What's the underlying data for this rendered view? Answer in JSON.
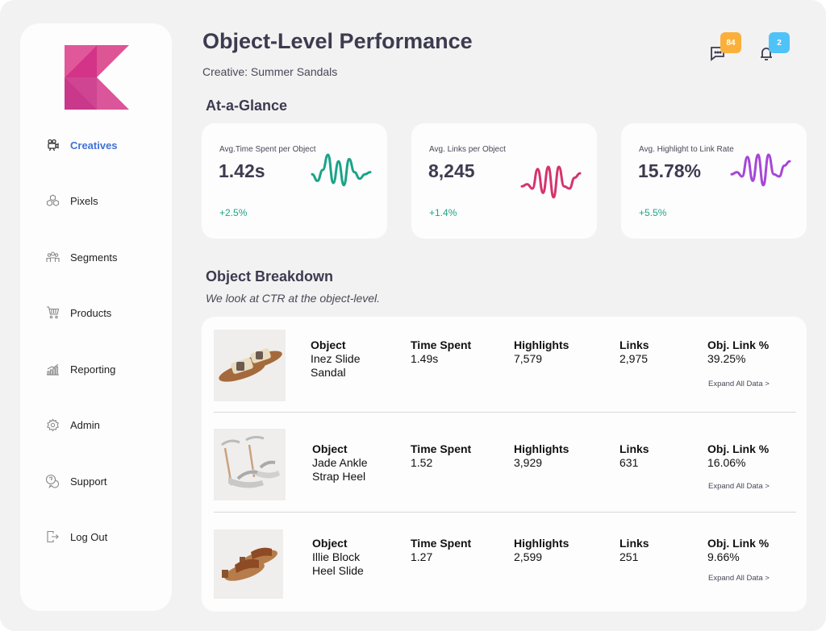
{
  "header": {
    "title": "Object-Level Performance",
    "subtitle": "Creative: Summer Sandals",
    "messages_count": "84",
    "notifications_count": "2",
    "messages_badge_color": "#fbb03b",
    "notifications_badge_color": "#4fc3f7"
  },
  "sidebar": {
    "items": [
      {
        "label": "Creatives",
        "icon": "camera-icon",
        "active": true
      },
      {
        "label": "Pixels",
        "icon": "cubes-icon"
      },
      {
        "label": "Segments",
        "icon": "people-icon"
      },
      {
        "label": "Products",
        "icon": "cart-icon"
      },
      {
        "label": "Reporting",
        "icon": "bar-chart-icon"
      },
      {
        "label": "Admin",
        "icon": "gear-icon"
      },
      {
        "label": "Support",
        "icon": "help-chat-icon"
      },
      {
        "label": "Log Out",
        "icon": "logout-icon"
      }
    ],
    "active_color": "#3f72d8"
  },
  "glance": {
    "title": "At-a-Glance",
    "cards": [
      {
        "label": "Avg.Time Spent per Object",
        "value": "1.42s",
        "delta": "+2.5%",
        "color": "#1aa388",
        "trend": [
          0.55,
          0.4,
          0.65,
          1.0,
          0.35,
          0.85,
          0.3,
          0.9,
          0.6,
          0.45,
          0.55,
          0.6
        ]
      },
      {
        "label": "Avg. Links per Object",
        "value": "8,245",
        "delta": "+1.4%",
        "color": "#d6336c",
        "trend": [
          0.55,
          0.6,
          0.5,
          0.95,
          0.4,
          1.0,
          0.3,
          1.0,
          0.55,
          0.5,
          0.75,
          0.85
        ]
      },
      {
        "label": "Avg. Highlight to Link Rate",
        "value": "15.78%",
        "delta": "+5.5%",
        "color": "#a646d8",
        "trend": [
          0.55,
          0.6,
          0.5,
          0.95,
          0.4,
          1.0,
          0.3,
          1.0,
          0.55,
          0.5,
          0.75,
          0.85
        ]
      }
    ]
  },
  "breakdown": {
    "title": "Object Breakdown",
    "subtitle": "We look at CTR at the object-level.",
    "columns": {
      "object": "Object",
      "time": "Time Spent",
      "highlights": "Highlights",
      "links": "Links",
      "link_pct": "Obj. Link %"
    },
    "expand_label": "Expand All Data >",
    "rows": [
      {
        "name_line1": "Inez Slide",
        "name_line2": "Sandal",
        "time": "1.49s",
        "highlights": "7,579",
        "links": "2,975",
        "link_pct": "39.25%",
        "image": "slide-sandal-image"
      },
      {
        "name_line1": "Jade Ankle",
        "name_line2": "Strap Heel",
        "time": "1.52",
        "highlights": "3,929",
        "links": "631",
        "link_pct": "16.06%",
        "image": "strap-heel-image"
      },
      {
        "name_line1": "Illie Block",
        "name_line2": "Heel Slide",
        "time": "1.27",
        "highlights": "2,599",
        "links": "251",
        "link_pct": "9.66%",
        "image": "block-heel-image"
      }
    ]
  }
}
